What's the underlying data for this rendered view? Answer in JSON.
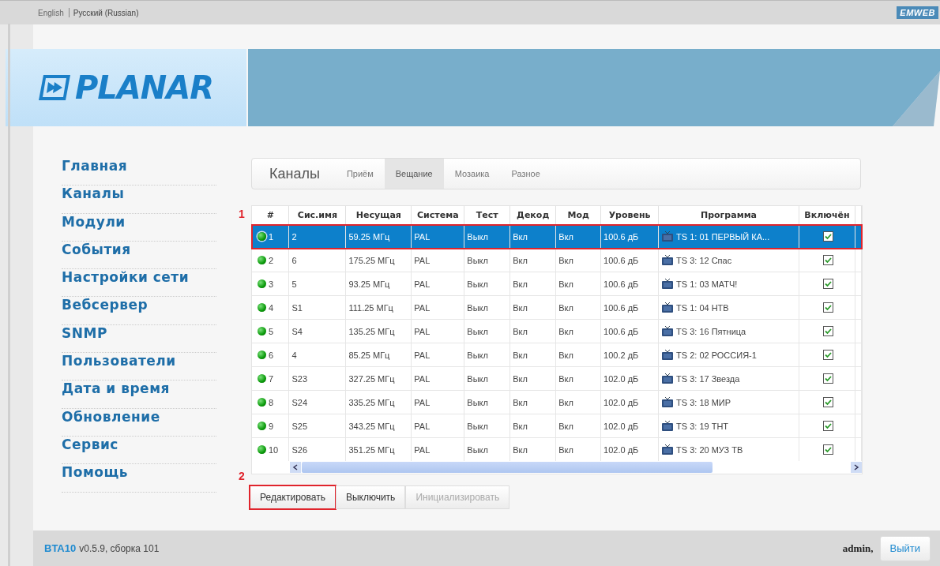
{
  "top_bar": {
    "languages": [
      {
        "label": "English",
        "selected": false
      },
      {
        "label": "Русский (Russian)",
        "selected": true
      }
    ],
    "brand": "EMWEB"
  },
  "banner": {
    "logo": "PLANAR"
  },
  "sidebar": {
    "items": [
      {
        "label": "Главная"
      },
      {
        "label": "Каналы"
      },
      {
        "label": "Модули"
      },
      {
        "label": "События"
      },
      {
        "label": "Настройки сети"
      },
      {
        "label": "Вебсервер"
      },
      {
        "label": "SNMP"
      },
      {
        "label": "Пользователи"
      },
      {
        "label": "Дата и время"
      },
      {
        "label": "Обновление"
      },
      {
        "label": "Сервис"
      },
      {
        "label": "Помощь"
      }
    ]
  },
  "section_title": "Каналы",
  "tabs": [
    {
      "label": "Приём",
      "selected": false
    },
    {
      "label": "Вещание",
      "selected": true
    },
    {
      "label": "Мозаика",
      "selected": false
    },
    {
      "label": "Разное",
      "selected": false
    }
  ],
  "table": {
    "columns": [
      "#",
      "Сис.имя",
      "Несущая",
      "Система",
      "Тест",
      "Декод",
      "Мод",
      "Уровень",
      "Программа",
      "Включён"
    ],
    "rows": [
      {
        "num": "1",
        "name": "2",
        "carrier": "59.25 МГц",
        "system": "PAL",
        "test": "Выкл",
        "decoder": "Вкл",
        "mod": "Вкл",
        "level_text": "100.6 дБ",
        "program": "TS 1: 01 ПЕРВЫЙ КА...",
        "enabled": true,
        "selected": true
      },
      {
        "num": "2",
        "name": "6",
        "carrier": "175.25 МГц",
        "system": "PAL",
        "test": "Выкл",
        "decoder": "Вкл",
        "mod": "Вкл",
        "level_text": "100.6 дБ",
        "program": "TS 3: 12 Спас",
        "enabled": true,
        "selected": false
      },
      {
        "num": "3",
        "name": "5",
        "carrier": "93.25 МГц",
        "system": "PAL",
        "test": "Выкл",
        "decoder": "Вкл",
        "mod": "Вкл",
        "level_text": "100.6 дБ",
        "program": "TS 1: 03 МАТЧ!",
        "enabled": true,
        "selected": false
      },
      {
        "num": "4",
        "name": "S1",
        "carrier": "111.25 МГц",
        "system": "PAL",
        "test": "Выкл",
        "decoder": "Вкл",
        "mod": "Вкл",
        "level_text": "100.6 дБ",
        "program": "TS 1: 04 НТВ",
        "enabled": true,
        "selected": false
      },
      {
        "num": "5",
        "name": "S4",
        "carrier": "135.25 МГц",
        "system": "PAL",
        "test": "Выкл",
        "decoder": "Вкл",
        "mod": "Вкл",
        "level_text": "100.6 дБ",
        "program": "TS 3: 16 Пятница",
        "enabled": true,
        "selected": false
      },
      {
        "num": "6",
        "name": "4",
        "carrier": "85.25 МГц",
        "system": "PAL",
        "test": "Выкл",
        "decoder": "Вкл",
        "mod": "Вкл",
        "level_text": "100.2 дБ",
        "program": "TS 2: 02 РОССИЯ-1",
        "enabled": true,
        "selected": false
      },
      {
        "num": "7",
        "name": "S23",
        "carrier": "327.25 МГц",
        "system": "PAL",
        "test": "Выкл",
        "decoder": "Вкл",
        "mod": "Вкл",
        "level_text": "102.0 дБ",
        "program": "TS 3: 17 Звезда",
        "enabled": true,
        "selected": false
      },
      {
        "num": "8",
        "name": "S24",
        "carrier": "335.25 МГц",
        "system": "PAL",
        "test": "Выкл",
        "decoder": "Вкл",
        "mod": "Вкл",
        "level_text": "102.0 дБ",
        "program": "TS 3: 18 МИР",
        "enabled": true,
        "selected": false
      },
      {
        "num": "9",
        "name": "S25",
        "carrier": "343.25 МГц",
        "system": "PAL",
        "test": "Выкл",
        "decoder": "Вкл",
        "mod": "Вкл",
        "level_text": "102.0 дБ",
        "program": "TS 3: 19 ТНТ",
        "enabled": true,
        "selected": false
      },
      {
        "num": "10",
        "name": "S26",
        "carrier": "351.25 МГц",
        "system": "PAL",
        "test": "Выкл",
        "decoder": "Вкл",
        "mod": "Вкл",
        "level_text": "102.0 дБ",
        "program": "TS 3: 20 МУЗ ТВ",
        "enabled": true,
        "selected": false
      }
    ]
  },
  "buttons": [
    {
      "label": "Редактировать",
      "disabled": false
    },
    {
      "label": "Выключить",
      "disabled": false
    },
    {
      "label": "Инициализировать",
      "disabled": true
    }
  ],
  "annotations": [
    "1",
    "2"
  ],
  "footer": {
    "product": "BTA10",
    "version": "v0.5.9, сборка 101",
    "user": "admin,",
    "logout": "Выйти"
  }
}
